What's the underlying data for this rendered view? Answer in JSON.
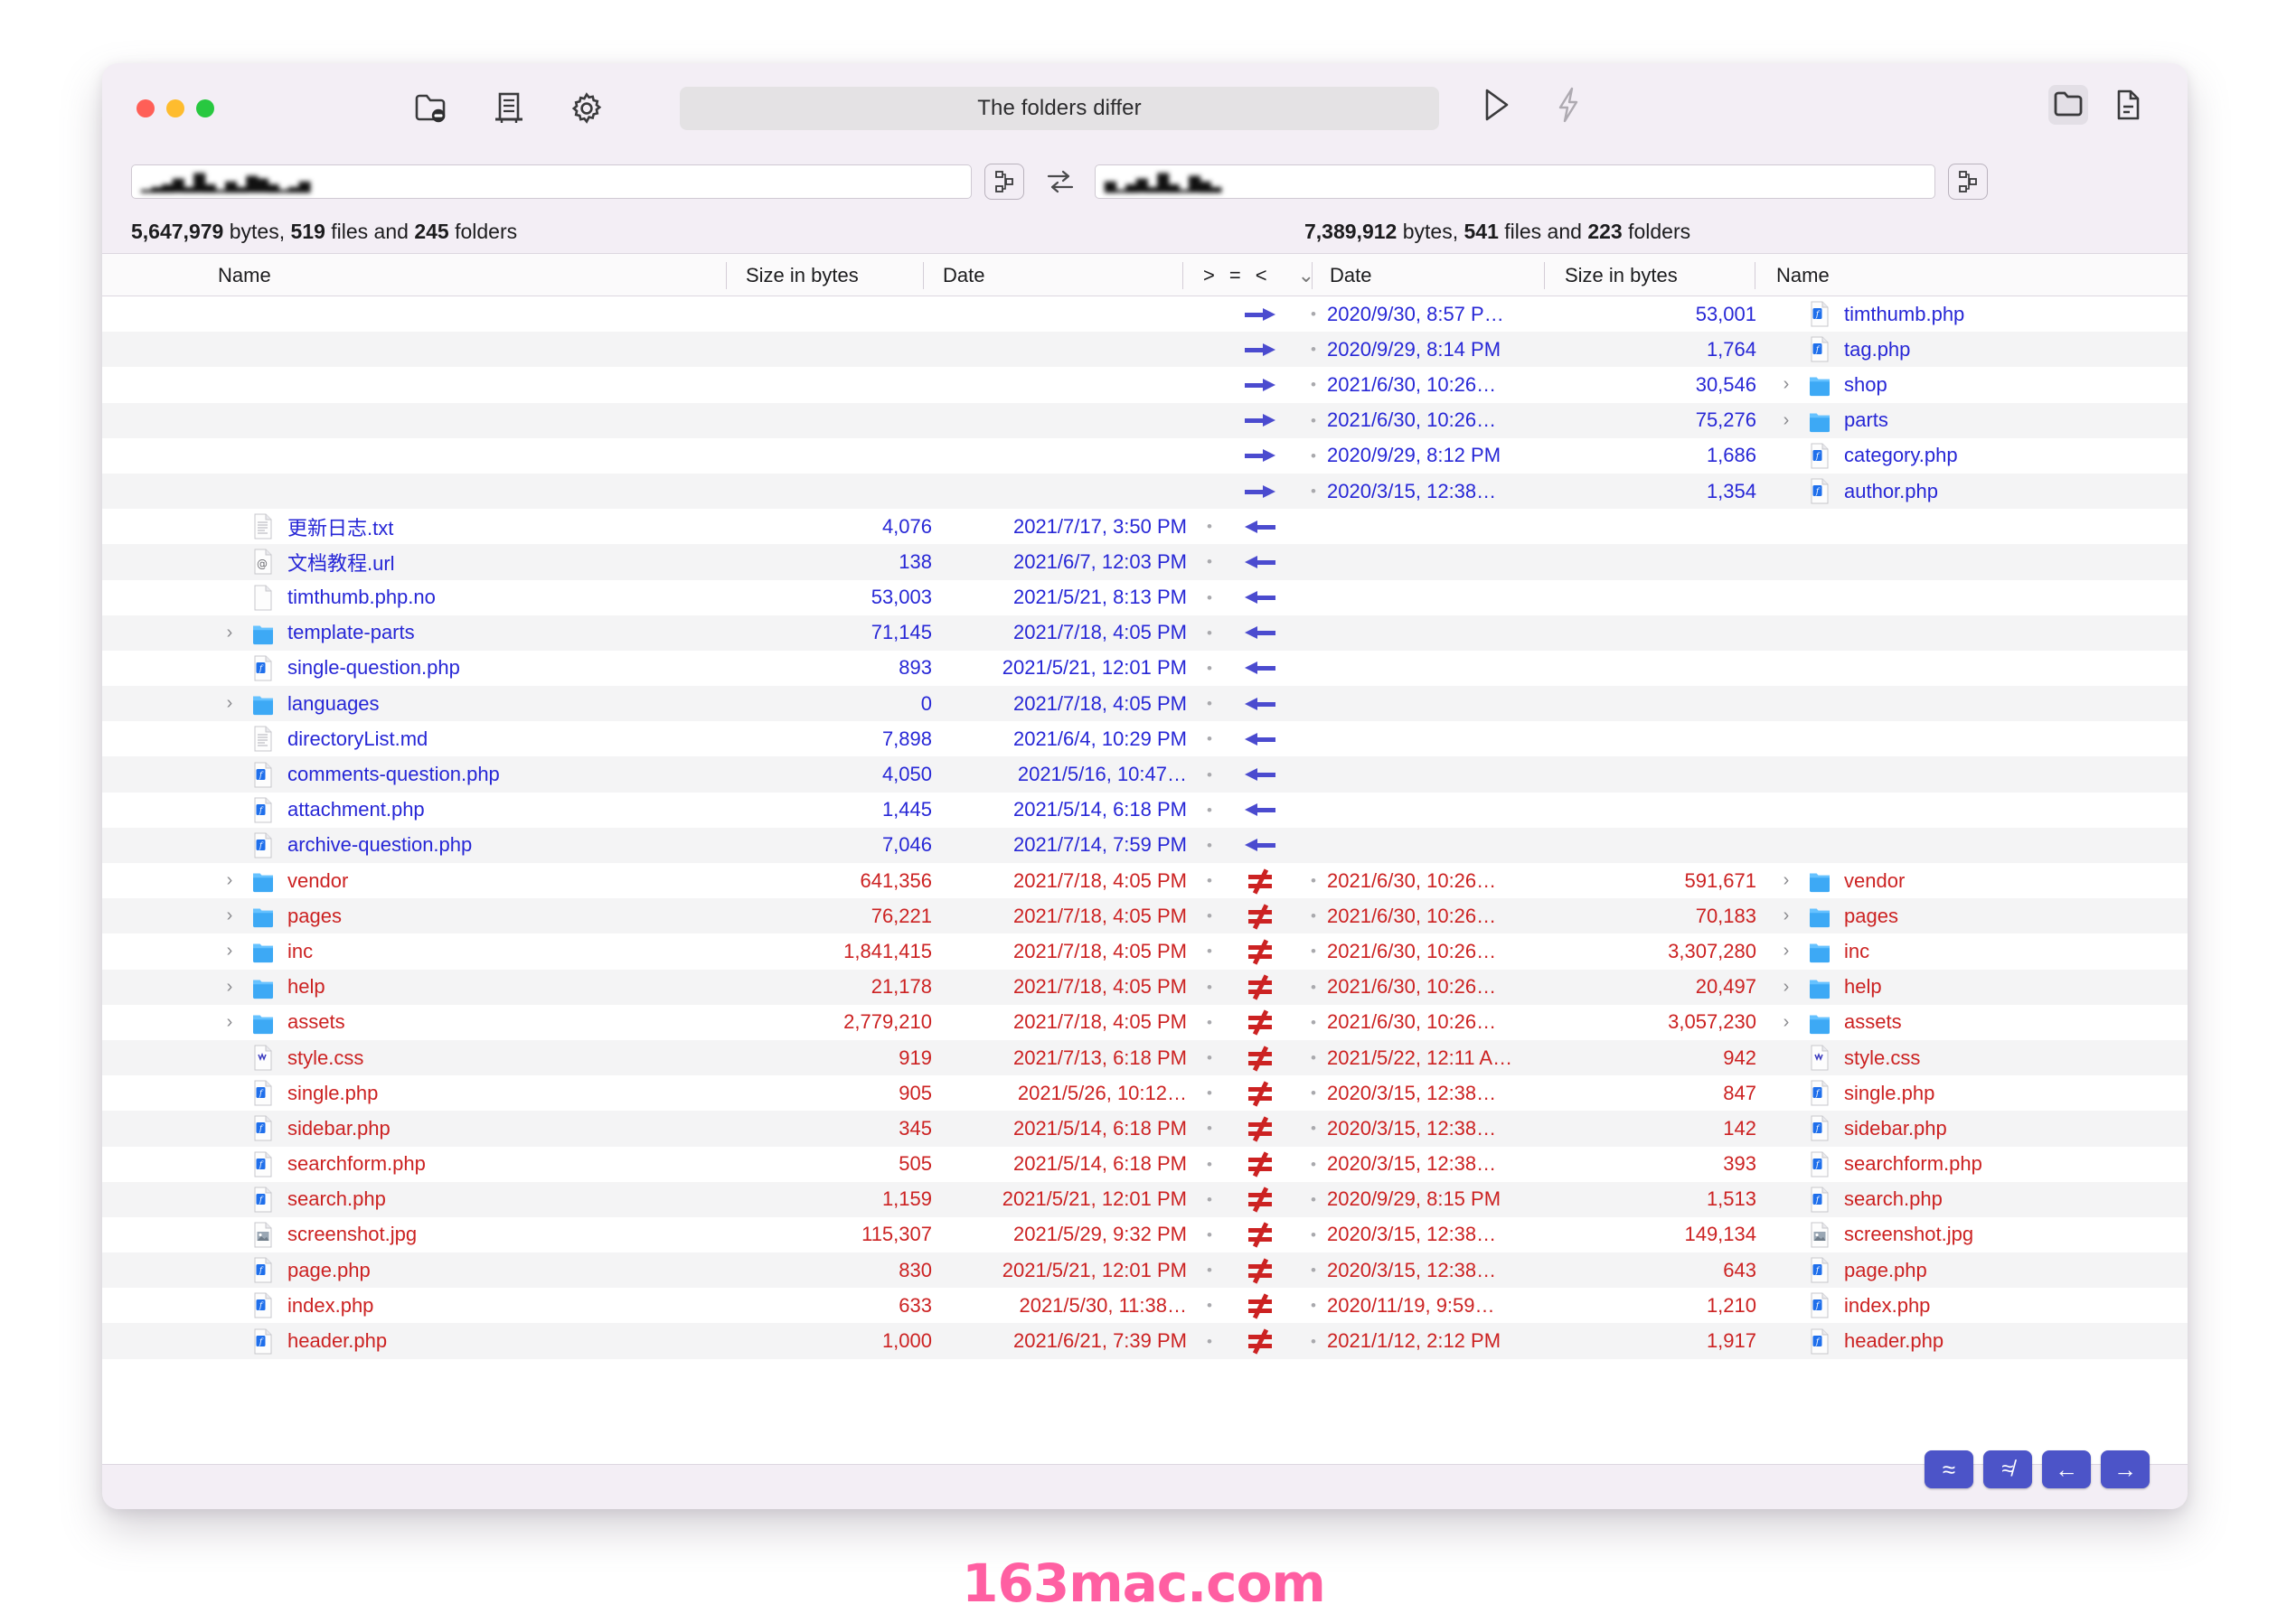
{
  "window": {
    "title": "The folders differ",
    "traffic_lights": [
      "close",
      "minimize",
      "zoom"
    ]
  },
  "toolbar": {
    "left_icons": [
      "folder-exclude-icon",
      "document-list-icon",
      "gear-icon"
    ],
    "mid_icons": [
      "play-icon",
      "lightning-icon"
    ],
    "right_icons": [
      "folder-compare-icon",
      "file-compare-icon"
    ]
  },
  "paths": {
    "left_value": "▁▂▃▅▂▇▃▁▄▂▆▅▃▁▂▄",
    "right_value": "▄▁▃▅▂▇▃▁▆▄▂",
    "left_browse_label": "⚯",
    "right_browse_label": "⚯",
    "swap_label": "⇄"
  },
  "summary": {
    "left": {
      "bytes": "5,647,979",
      "bytes_label": "bytes,",
      "files": "519",
      "files_label": "files and",
      "folders": "245",
      "folders_label": "folders"
    },
    "right": {
      "bytes": "7,389,912",
      "bytes_label": "bytes,",
      "files": "541",
      "files_label": "files and",
      "folders": "223",
      "folders_label": "folders"
    }
  },
  "headers": {
    "left_name": "Name",
    "left_size": "Size in bytes",
    "left_date": "Date",
    "compare_ops": [
      ">",
      "=",
      "<"
    ],
    "compare_chevron": "⌄",
    "right_date": "Date",
    "right_size": "Size in bytes",
    "right_name": "Name"
  },
  "footer_buttons": [
    {
      "name": "approximately-equal-button",
      "label": "≈"
    },
    {
      "name": "not-approximately-equal-button",
      "label": "≉"
    },
    {
      "name": "copy-left-button",
      "label": "←"
    },
    {
      "name": "copy-right-button",
      "label": "→"
    }
  ],
  "watermark": "163mac.com",
  "rows": [
    {
      "state": "right-only",
      "indicator": "arrow-right",
      "color": "blue",
      "right": {
        "date": "2020/9/30, 8:57 P…",
        "size": "53,001",
        "icon": "php-file-icon",
        "name": "timthumb.php",
        "twisty": ""
      }
    },
    {
      "state": "right-only",
      "indicator": "arrow-right",
      "color": "blue",
      "right": {
        "date": "2020/9/29, 8:14 PM",
        "size": "1,764",
        "icon": "php-file-icon",
        "name": "tag.php",
        "twisty": ""
      }
    },
    {
      "state": "right-only",
      "indicator": "arrow-right",
      "color": "blue",
      "right": {
        "date": "2021/6/30, 10:26…",
        "size": "30,546",
        "icon": "folder-icon",
        "name": "shop",
        "twisty": "›"
      }
    },
    {
      "state": "right-only",
      "indicator": "arrow-right",
      "color": "blue",
      "right": {
        "date": "2021/6/30, 10:26…",
        "size": "75,276",
        "icon": "folder-icon",
        "name": "parts",
        "twisty": "›"
      }
    },
    {
      "state": "right-only",
      "indicator": "arrow-right",
      "color": "blue",
      "right": {
        "date": "2020/9/29, 8:12 PM",
        "size": "1,686",
        "icon": "php-file-icon",
        "name": "category.php",
        "twisty": ""
      }
    },
    {
      "state": "right-only",
      "indicator": "arrow-right",
      "color": "blue",
      "right": {
        "date": "2020/3/15, 12:38…",
        "size": "1,354",
        "icon": "php-file-icon",
        "name": "author.php",
        "twisty": ""
      }
    },
    {
      "state": "left-only",
      "indicator": "arrow-left",
      "color": "blue",
      "left": {
        "twisty": "",
        "icon": "text-file-icon",
        "name": "更新日志.txt",
        "size": "4,076",
        "date": "2021/7/17, 3:50 PM"
      }
    },
    {
      "state": "left-only",
      "indicator": "arrow-left",
      "color": "blue",
      "left": {
        "twisty": "",
        "icon": "url-file-icon",
        "name": "文档教程.url",
        "size": "138",
        "date": "2021/6/7, 12:03 PM"
      }
    },
    {
      "state": "left-only",
      "indicator": "arrow-left",
      "color": "blue",
      "left": {
        "twisty": "",
        "icon": "blank-file-icon",
        "name": "timthumb.php.no",
        "size": "53,003",
        "date": "2021/5/21, 8:13 PM"
      }
    },
    {
      "state": "left-only",
      "indicator": "arrow-left",
      "color": "blue",
      "left": {
        "twisty": "›",
        "icon": "folder-icon",
        "name": "template-parts",
        "size": "71,145",
        "date": "2021/7/18, 4:05 PM"
      }
    },
    {
      "state": "left-only",
      "indicator": "arrow-left",
      "color": "blue",
      "left": {
        "twisty": "",
        "icon": "php-file-icon",
        "name": "single-question.php",
        "size": "893",
        "date": "2021/5/21, 12:01 PM"
      }
    },
    {
      "state": "left-only",
      "indicator": "arrow-left",
      "color": "blue",
      "left": {
        "twisty": "›",
        "icon": "folder-icon",
        "name": "languages",
        "size": "0",
        "date": "2021/7/18, 4:05 PM"
      }
    },
    {
      "state": "left-only",
      "indicator": "arrow-left",
      "color": "blue",
      "left": {
        "twisty": "",
        "icon": "text-file-icon",
        "name": "directoryList.md",
        "size": "7,898",
        "date": "2021/6/4, 10:29 PM"
      }
    },
    {
      "state": "left-only",
      "indicator": "arrow-left",
      "color": "blue",
      "left": {
        "twisty": "",
        "icon": "php-file-icon",
        "name": "comments-question.php",
        "size": "4,050",
        "date": "2021/5/16, 10:47…"
      }
    },
    {
      "state": "left-only",
      "indicator": "arrow-left",
      "color": "blue",
      "left": {
        "twisty": "",
        "icon": "php-file-icon",
        "name": "attachment.php",
        "size": "1,445",
        "date": "2021/5/14, 6:18 PM"
      }
    },
    {
      "state": "left-only",
      "indicator": "arrow-left",
      "color": "blue",
      "left": {
        "twisty": "",
        "icon": "php-file-icon",
        "name": "archive-question.php",
        "size": "7,046",
        "date": "2021/7/14, 7:59 PM"
      }
    },
    {
      "state": "differ",
      "indicator": "not-equal",
      "color": "red",
      "left": {
        "twisty": "›",
        "icon": "folder-icon",
        "name": "vendor",
        "size": "641,356",
        "date": "2021/7/18, 4:05 PM"
      },
      "right": {
        "date": "2021/6/30, 10:26…",
        "size": "591,671",
        "icon": "folder-icon",
        "name": "vendor",
        "twisty": "›"
      }
    },
    {
      "state": "differ",
      "indicator": "not-equal",
      "color": "red",
      "left": {
        "twisty": "›",
        "icon": "folder-icon",
        "name": "pages",
        "size": "76,221",
        "date": "2021/7/18, 4:05 PM"
      },
      "right": {
        "date": "2021/6/30, 10:26…",
        "size": "70,183",
        "icon": "folder-icon",
        "name": "pages",
        "twisty": "›"
      }
    },
    {
      "state": "differ",
      "indicator": "not-equal",
      "color": "red",
      "left": {
        "twisty": "›",
        "icon": "folder-icon",
        "name": "inc",
        "size": "1,841,415",
        "date": "2021/7/18, 4:05 PM"
      },
      "right": {
        "date": "2021/6/30, 10:26…",
        "size": "3,307,280",
        "icon": "folder-icon",
        "name": "inc",
        "twisty": "›"
      }
    },
    {
      "state": "differ",
      "indicator": "not-equal",
      "color": "red",
      "left": {
        "twisty": "›",
        "icon": "folder-icon",
        "name": "help",
        "size": "21,178",
        "date": "2021/7/18, 4:05 PM"
      },
      "right": {
        "date": "2021/6/30, 10:26…",
        "size": "20,497",
        "icon": "folder-icon",
        "name": "help",
        "twisty": "›"
      }
    },
    {
      "state": "differ",
      "indicator": "not-equal",
      "color": "red",
      "left": {
        "twisty": "›",
        "icon": "folder-icon",
        "name": "assets",
        "size": "2,779,210",
        "date": "2021/7/18, 4:05 PM"
      },
      "right": {
        "date": "2021/6/30, 10:26…",
        "size": "3,057,230",
        "icon": "folder-icon",
        "name": "assets",
        "twisty": "›"
      }
    },
    {
      "state": "differ",
      "indicator": "not-equal",
      "color": "red",
      "left": {
        "twisty": "",
        "icon": "css-file-icon",
        "name": "style.css",
        "size": "919",
        "date": "2021/7/13, 6:18 PM"
      },
      "right": {
        "date": "2021/5/22, 12:11 A…",
        "size": "942",
        "icon": "css-file-icon",
        "name": "style.css",
        "twisty": ""
      }
    },
    {
      "state": "differ",
      "indicator": "not-equal",
      "color": "red",
      "left": {
        "twisty": "",
        "icon": "php-file-icon",
        "name": "single.php",
        "size": "905",
        "date": "2021/5/26, 10:12…"
      },
      "right": {
        "date": "2020/3/15, 12:38…",
        "size": "847",
        "icon": "php-file-icon",
        "name": "single.php",
        "twisty": ""
      }
    },
    {
      "state": "differ",
      "indicator": "not-equal",
      "color": "red",
      "left": {
        "twisty": "",
        "icon": "php-file-icon",
        "name": "sidebar.php",
        "size": "345",
        "date": "2021/5/14, 6:18 PM"
      },
      "right": {
        "date": "2020/3/15, 12:38…",
        "size": "142",
        "icon": "php-file-icon",
        "name": "sidebar.php",
        "twisty": ""
      }
    },
    {
      "state": "differ",
      "indicator": "not-equal",
      "color": "red",
      "left": {
        "twisty": "",
        "icon": "php-file-icon",
        "name": "searchform.php",
        "size": "505",
        "date": "2021/5/14, 6:18 PM"
      },
      "right": {
        "date": "2020/3/15, 12:38…",
        "size": "393",
        "icon": "php-file-icon",
        "name": "searchform.php",
        "twisty": ""
      }
    },
    {
      "state": "differ",
      "indicator": "not-equal",
      "color": "red",
      "left": {
        "twisty": "",
        "icon": "php-file-icon",
        "name": "search.php",
        "size": "1,159",
        "date": "2021/5/21, 12:01 PM"
      },
      "right": {
        "date": "2020/9/29, 8:15 PM",
        "size": "1,513",
        "icon": "php-file-icon",
        "name": "search.php",
        "twisty": ""
      }
    },
    {
      "state": "differ",
      "indicator": "not-equal",
      "color": "red",
      "left": {
        "twisty": "",
        "icon": "image-file-icon",
        "name": "screenshot.jpg",
        "size": "115,307",
        "date": "2021/5/29, 9:32 PM"
      },
      "right": {
        "date": "2020/3/15, 12:38…",
        "size": "149,134",
        "icon": "image-file-icon",
        "name": "screenshot.jpg",
        "twisty": ""
      }
    },
    {
      "state": "differ",
      "indicator": "not-equal",
      "color": "red",
      "left": {
        "twisty": "",
        "icon": "php-file-icon",
        "name": "page.php",
        "size": "830",
        "date": "2021/5/21, 12:01 PM"
      },
      "right": {
        "date": "2020/3/15, 12:38…",
        "size": "643",
        "icon": "php-file-icon",
        "name": "page.php",
        "twisty": ""
      }
    },
    {
      "state": "differ",
      "indicator": "not-equal",
      "color": "red",
      "left": {
        "twisty": "",
        "icon": "php-file-icon",
        "name": "index.php",
        "size": "633",
        "date": "2021/5/30, 11:38…"
      },
      "right": {
        "date": "2020/11/19, 9:59…",
        "size": "1,210",
        "icon": "php-file-icon",
        "name": "index.php",
        "twisty": ""
      }
    },
    {
      "state": "differ",
      "indicator": "not-equal",
      "color": "red",
      "left": {
        "twisty": "",
        "icon": "php-file-icon",
        "name": "header.php",
        "size": "1,000",
        "date": "2021/6/21, 7:39 PM"
      },
      "right": {
        "date": "2021/1/12, 2:12 PM",
        "size": "1,917",
        "icon": "php-file-icon",
        "name": "header.php",
        "twisty": ""
      }
    }
  ]
}
